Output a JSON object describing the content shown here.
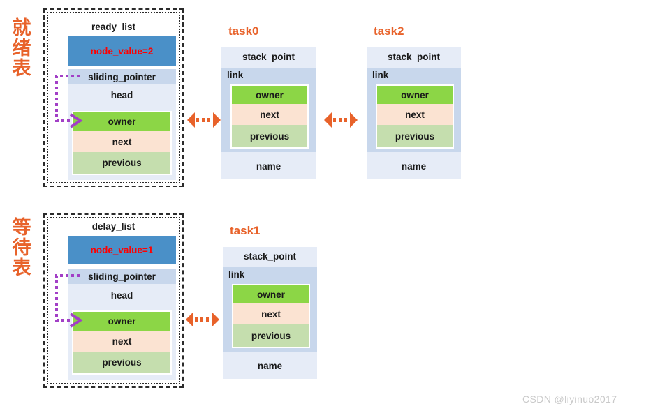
{
  "labels": {
    "ready_group_cn": "就绪表",
    "delay_group_cn": "等待表"
  },
  "lists": [
    {
      "id": "ready_list",
      "title": "ready_list",
      "node_value": "node_value=2",
      "sliding_pointer": "sliding_pointer",
      "head": "head",
      "fields": [
        "owner",
        "next",
        "previous"
      ]
    },
    {
      "id": "delay_list",
      "title": "delay_list",
      "node_value": "node_value=1",
      "sliding_pointer": "sliding_pointer",
      "head": "head",
      "fields": [
        "owner",
        "next",
        "previous"
      ]
    }
  ],
  "tasks": [
    {
      "id": "task0",
      "title": "task0",
      "stack_point": "stack_point",
      "link": "link",
      "fields": [
        "owner",
        "next",
        "previous"
      ],
      "name": "name"
    },
    {
      "id": "task2",
      "title": "task2",
      "stack_point": "stack_point",
      "link": "link",
      "fields": [
        "owner",
        "next",
        "previous"
      ],
      "name": "name"
    },
    {
      "id": "task1",
      "title": "task1",
      "stack_point": "stack_point",
      "link": "link",
      "fields": [
        "owner",
        "next",
        "previous"
      ],
      "name": "name"
    }
  ],
  "colors": {
    "accent_orange": "#E8622A",
    "node_value_blue": "#4A90C8",
    "node_value_text_red": "#FF0000",
    "sliding_pointer_blue": "#C8D7EC",
    "head_blue": "#E6ECF7",
    "owner_green": "#8CD646",
    "next_peach": "#FBE3D2",
    "previous_green": "#C5DEAE",
    "pointer_purple": "#A23FC6",
    "watermark_gray": "#c9c9c9"
  },
  "watermark": "CSDN @liyinuo2017"
}
